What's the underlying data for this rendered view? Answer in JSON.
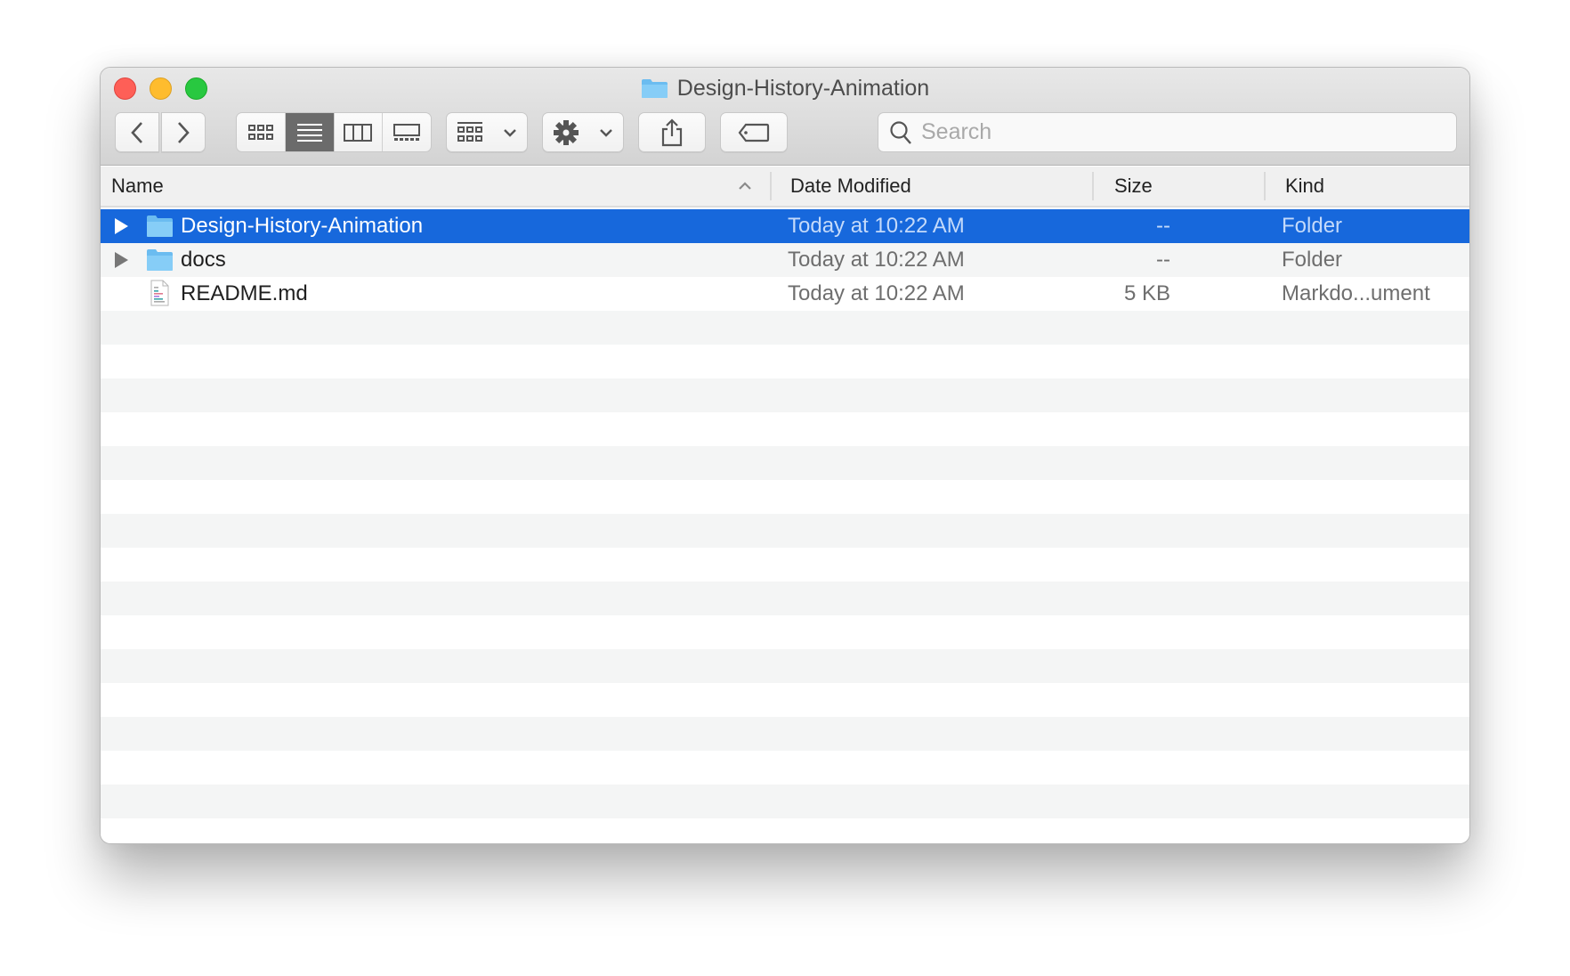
{
  "window": {
    "title": "Design-History-Animation",
    "controls": {
      "close": "close",
      "minimize": "minimize",
      "zoom": "zoom"
    }
  },
  "toolbar": {
    "back_icon": "chevron-left-icon",
    "forward_icon": "chevron-right-icon",
    "view_modes": [
      {
        "name": "icon-view",
        "active": false
      },
      {
        "name": "list-view",
        "active": true
      },
      {
        "name": "column-view",
        "active": false
      },
      {
        "name": "gallery-view",
        "active": false
      }
    ],
    "group_icon": "group-by-icon",
    "action_icon": "gear-icon",
    "share_icon": "share-icon",
    "tag_icon": "tag-icon",
    "search": {
      "placeholder": "Search",
      "value": ""
    }
  },
  "columns": {
    "name": "Name",
    "date": "Date Modified",
    "size": "Size",
    "kind": "Kind",
    "sort": {
      "column": "Name",
      "direction": "ascending"
    }
  },
  "files": [
    {
      "name": "Design-History-Animation",
      "date": "Today at 10:22 AM",
      "size": "--",
      "kind": "Folder",
      "type": "folder",
      "selected": true
    },
    {
      "name": "docs",
      "date": "Today at 10:22 AM",
      "size": "--",
      "kind": "Folder",
      "type": "folder",
      "selected": false
    },
    {
      "name": "README.md",
      "date": "Today at 10:22 AM",
      "size": "5 KB",
      "kind": "Markdo...ument",
      "type": "markdown",
      "selected": false
    }
  ],
  "colors": {
    "selection": "#1768dc",
    "stripe": "#f4f5f5",
    "folder": "#7cc6f4"
  }
}
